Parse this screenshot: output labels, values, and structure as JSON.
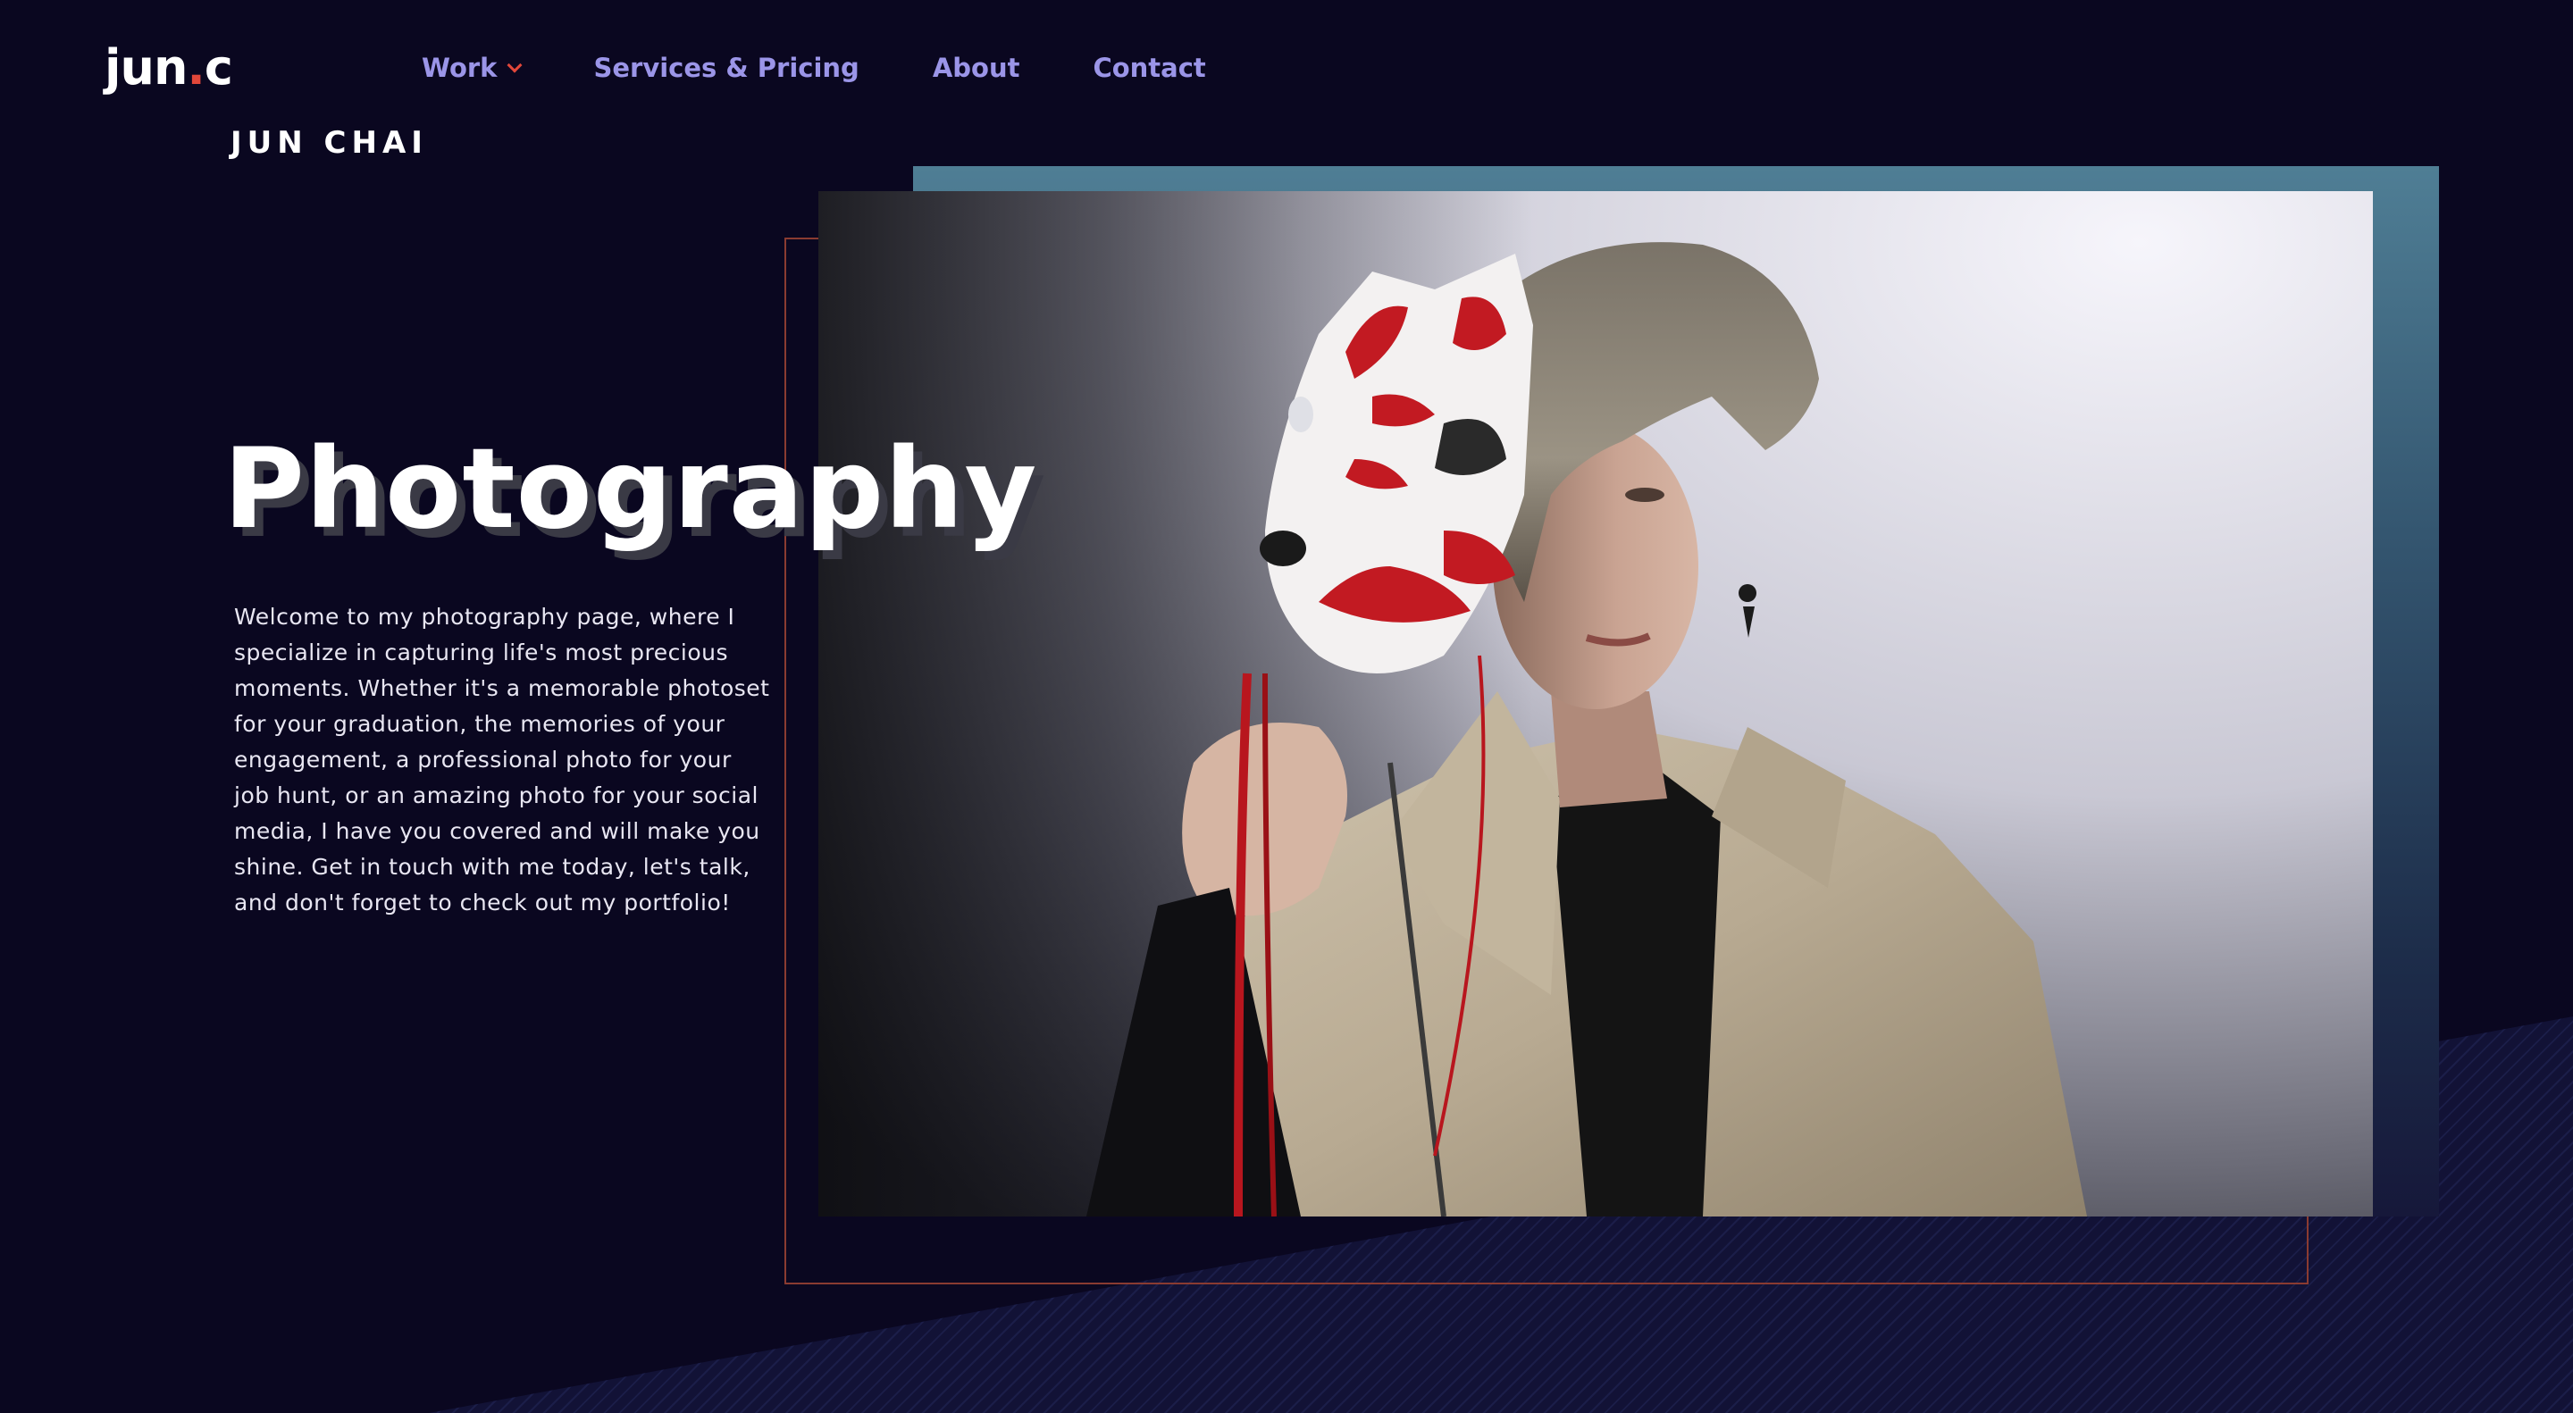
{
  "site": {
    "logo_main": "jun",
    "logo_dot": ".",
    "logo_end": "c"
  },
  "nav": {
    "items": [
      {
        "label": "Work",
        "has_dropdown": true
      },
      {
        "label": "Services & Pricing",
        "has_dropdown": false
      },
      {
        "label": "About",
        "has_dropdown": false
      },
      {
        "label": "Contact",
        "has_dropdown": false
      }
    ]
  },
  "hero": {
    "name": "JUN CHAI",
    "title": "Photography",
    "description": "Welcome to my photography page, where I specialize in capturing life's most precious moments. Whether it's a memorable photoset for your graduation, the memories of your engagement, a professional photo for your job hunt, or an amazing photo for your social media, I have you covered and will make you shine. Get in touch with me today, let's talk, and don't forget to check out my portfolio!"
  },
  "colors": {
    "background": "#0a0720",
    "accent": "#e2473a",
    "nav_text": "#9b95e8",
    "teal_block": "#4f7e95",
    "frame": "#8a3b31"
  },
  "icons": {
    "dropdown": "chevron-down-icon"
  }
}
